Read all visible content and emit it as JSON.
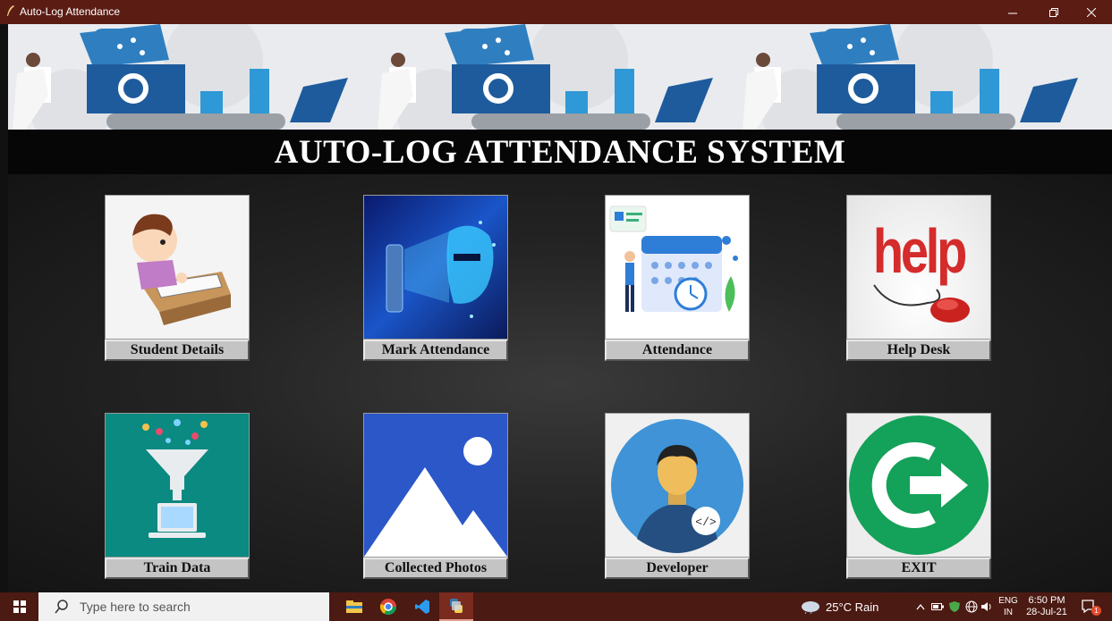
{
  "window": {
    "title": "Auto-Log Attendance"
  },
  "heading": "AUTO-LOG ATTENDANCE SYSTEM",
  "tiles": [
    {
      "label": "Student Details"
    },
    {
      "label": "Mark Attendance"
    },
    {
      "label": "Attendance"
    },
    {
      "label": "Help Desk"
    },
    {
      "label": "Train Data"
    },
    {
      "label": "Collected Photos"
    },
    {
      "label": "Developer"
    },
    {
      "label": "EXIT"
    }
  ],
  "help_image_text": "help",
  "taskbar": {
    "search_placeholder": "Type here to search",
    "weather": "25°C  Rain",
    "lang_top": "ENG",
    "lang_bottom": "IN",
    "time": "6:50 PM",
    "date": "28-Jul-21",
    "notification_count": "1"
  },
  "colors": {
    "titlebar": "#5b1c14",
    "taskbar": "#4b1a12",
    "label_bg": "#c4c4c4"
  }
}
